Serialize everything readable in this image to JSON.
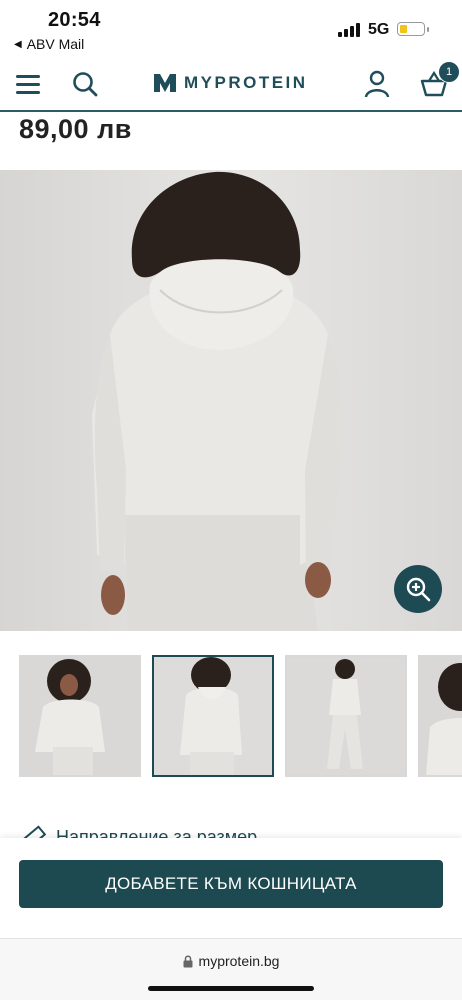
{
  "status_bar": {
    "time": "20:54",
    "back_app": "ABV Mail",
    "network": "5G",
    "battery_level": 0.3
  },
  "header": {
    "logo_text": "MYPROTEIN",
    "basket_count": "1",
    "brand_color": "#1f4e5a"
  },
  "product": {
    "price": "89,00 лв",
    "thumbnails": [
      "front-view",
      "back-view",
      "full-length-view",
      "side-view"
    ],
    "active_thumbnail": 2
  },
  "size_guide": {
    "label": "Направление за размер"
  },
  "cart": {
    "add_label": "ДОБАВЕТЕ КЪМ КОШНИЦАТА"
  },
  "browser": {
    "url": "myprotein.bg"
  }
}
